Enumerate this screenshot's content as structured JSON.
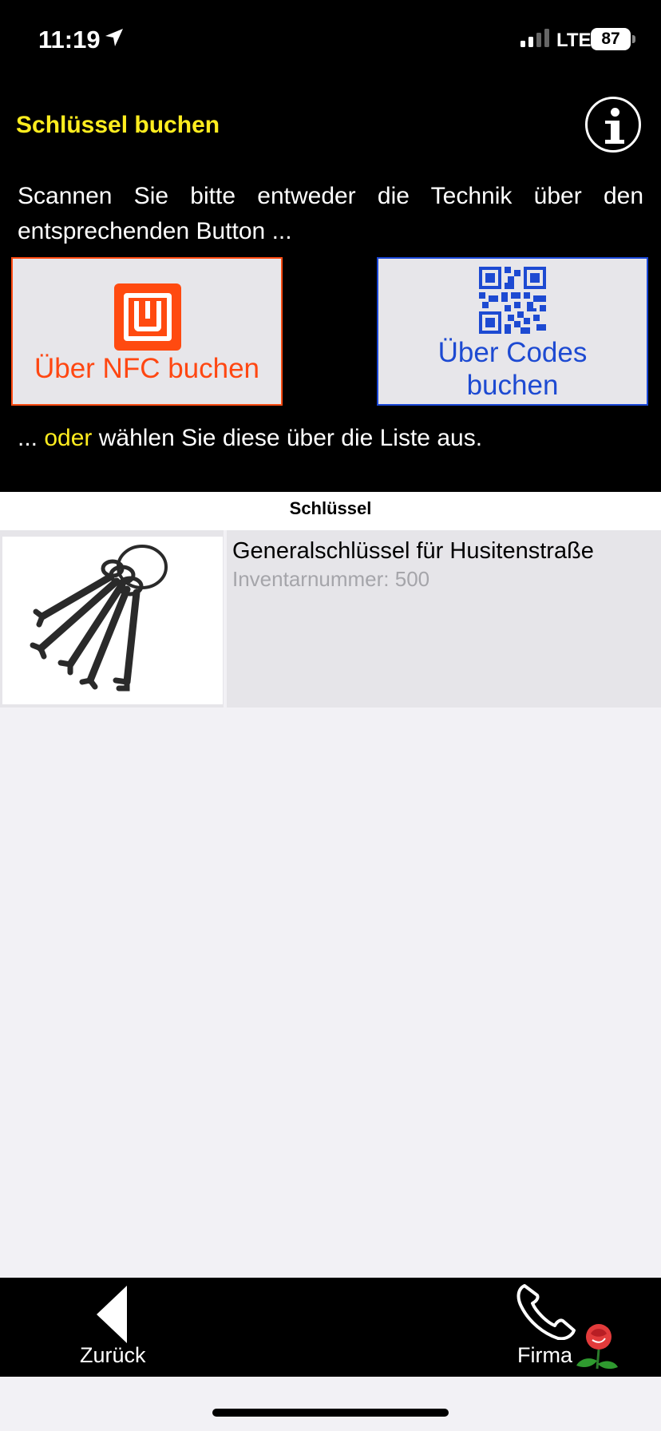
{
  "status_bar": {
    "time": "11:19",
    "network": "LTE",
    "battery": "87"
  },
  "header": {
    "title": "Schlüssel buchen"
  },
  "instructions": {
    "line1": "Scannen Sie bitte entweder die Technik über den entsprechenden Button ...",
    "or_prefix": "... ",
    "or_highlight": "oder",
    "or_suffix": " wählen Sie diese über die Liste aus."
  },
  "buttons": {
    "nfc_label": "Über NFC buchen",
    "codes_label_line1": "Über Codes",
    "codes_label_line2": "buchen"
  },
  "list": {
    "section_title": "Schlüssel",
    "items": [
      {
        "name": "Generalschlüssel für Husitenstraße",
        "inventory": "Inventarnummer: 500"
      }
    ]
  },
  "tabbar": {
    "back_label": "Zurück",
    "company_label": "Firma"
  },
  "colors": {
    "accent_yellow": "#ffed1f",
    "nfc_orange": "#ff4712",
    "codes_blue": "#1d4ad2"
  }
}
